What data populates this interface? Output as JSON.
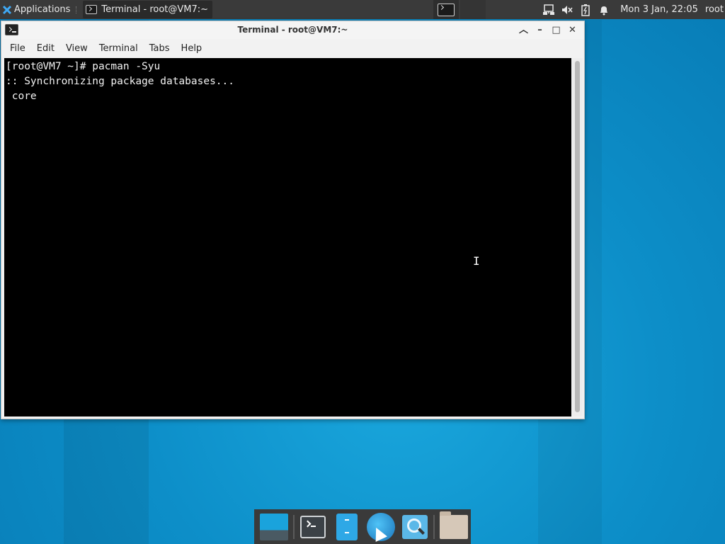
{
  "panel": {
    "applications_label": "Applications",
    "task_title": "Terminal - root@VM7:~",
    "clock": "Mon  3 Jan, 22:05",
    "user": "root",
    "tray_icons": [
      "network-icon",
      "volume-muted-icon",
      "battery-icon",
      "notification-bell-icon"
    ]
  },
  "window": {
    "title": "Terminal - root@VM7:~",
    "menu": [
      "File",
      "Edit",
      "View",
      "Terminal",
      "Tabs",
      "Help"
    ],
    "lines": [
      "[root@VM7 ~]# pacman -Syu",
      ":: Synchronizing package databases...",
      " core"
    ]
  },
  "dock": {
    "items": [
      "show-desktop",
      "terminal",
      "file-manager",
      "web-browser",
      "app-finder",
      "home-folder"
    ]
  }
}
